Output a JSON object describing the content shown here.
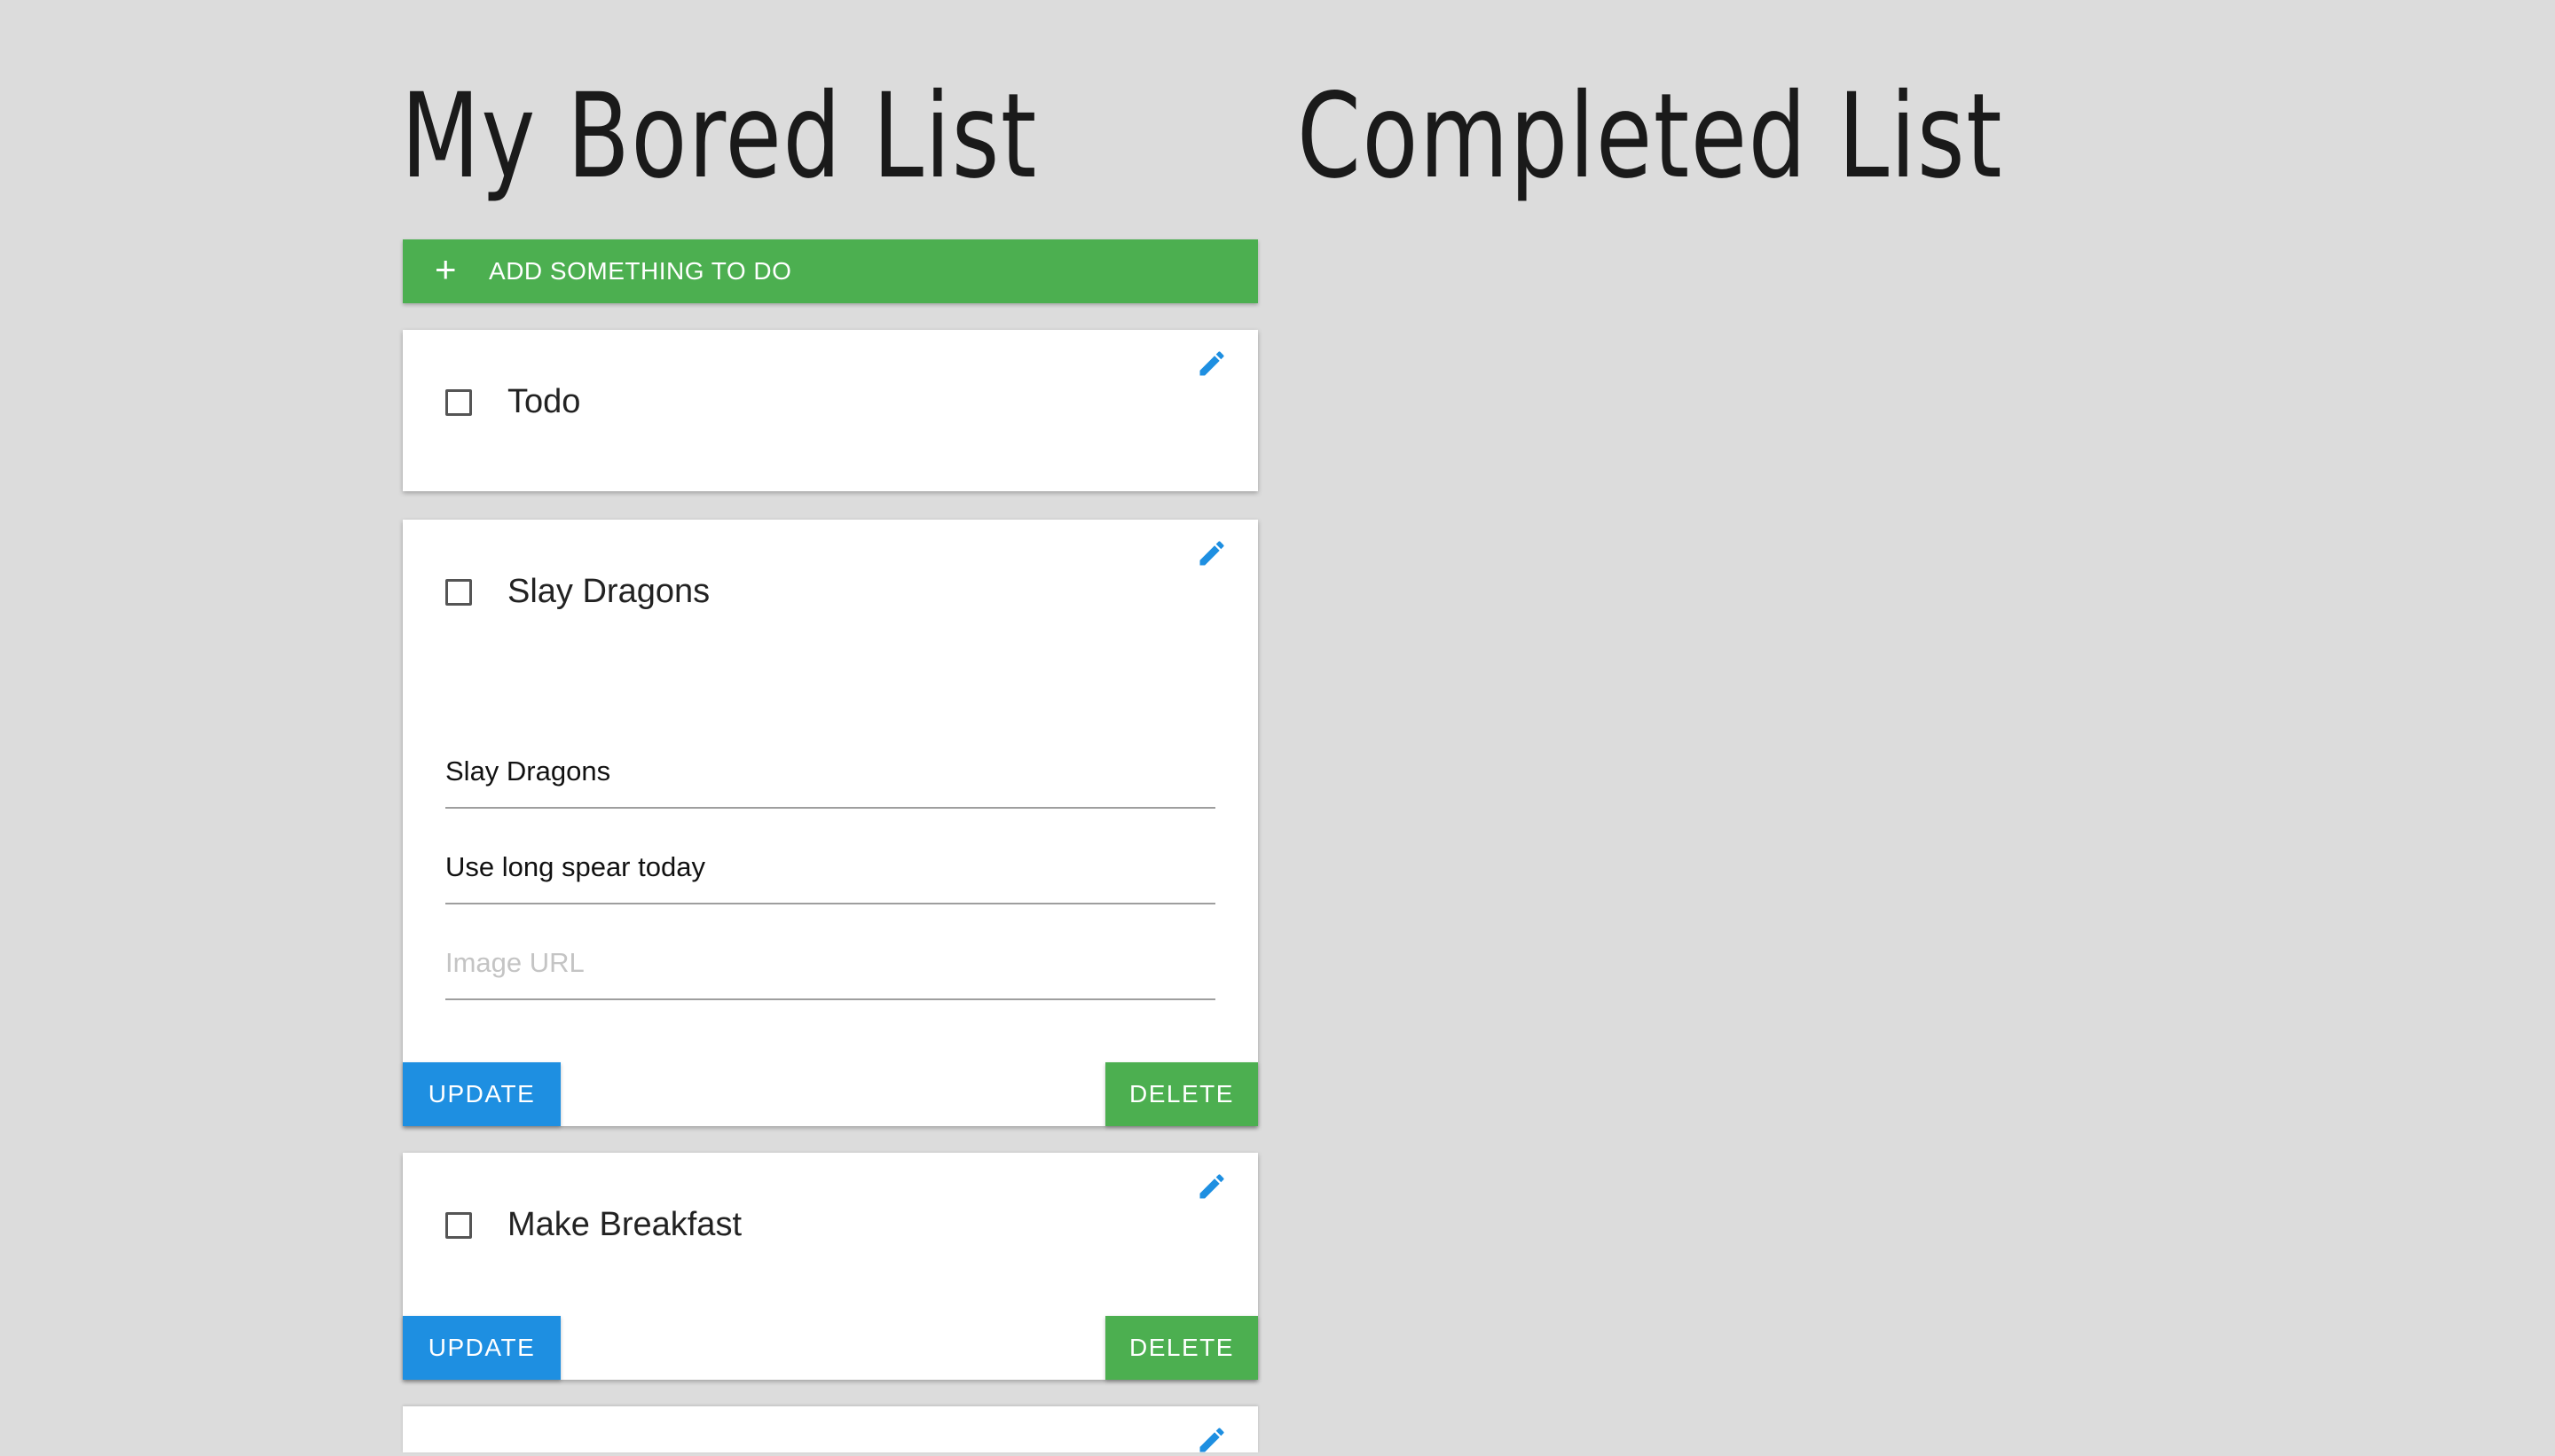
{
  "left_column": {
    "heading": "My Bored List",
    "add_button": {
      "icon": "plus-icon",
      "label": "ADD SOMETHING TO DO"
    }
  },
  "right_column": {
    "heading": "Completed List"
  },
  "cards": [
    {
      "title": "Todo",
      "checked": false
    },
    {
      "title": "Slay Dragons",
      "checked": false,
      "fields": {
        "title_value": "Slay Dragons",
        "description_value": "Use long spear today",
        "image_url_placeholder": "Image URL"
      },
      "update_label": "UPDATE",
      "delete_label": "DELETE"
    },
    {
      "title": "Make Breakfast",
      "checked": false,
      "update_label": "UPDATE",
      "delete_label": "DELETE"
    }
  ],
  "colors": {
    "background": "#dcdcdc",
    "green": "#4caf50",
    "blue": "#1e8fe1"
  },
  "icons": {
    "edit": "pencil-icon",
    "add": "plus-icon",
    "checkbox": "checkbox-unchecked-icon"
  }
}
